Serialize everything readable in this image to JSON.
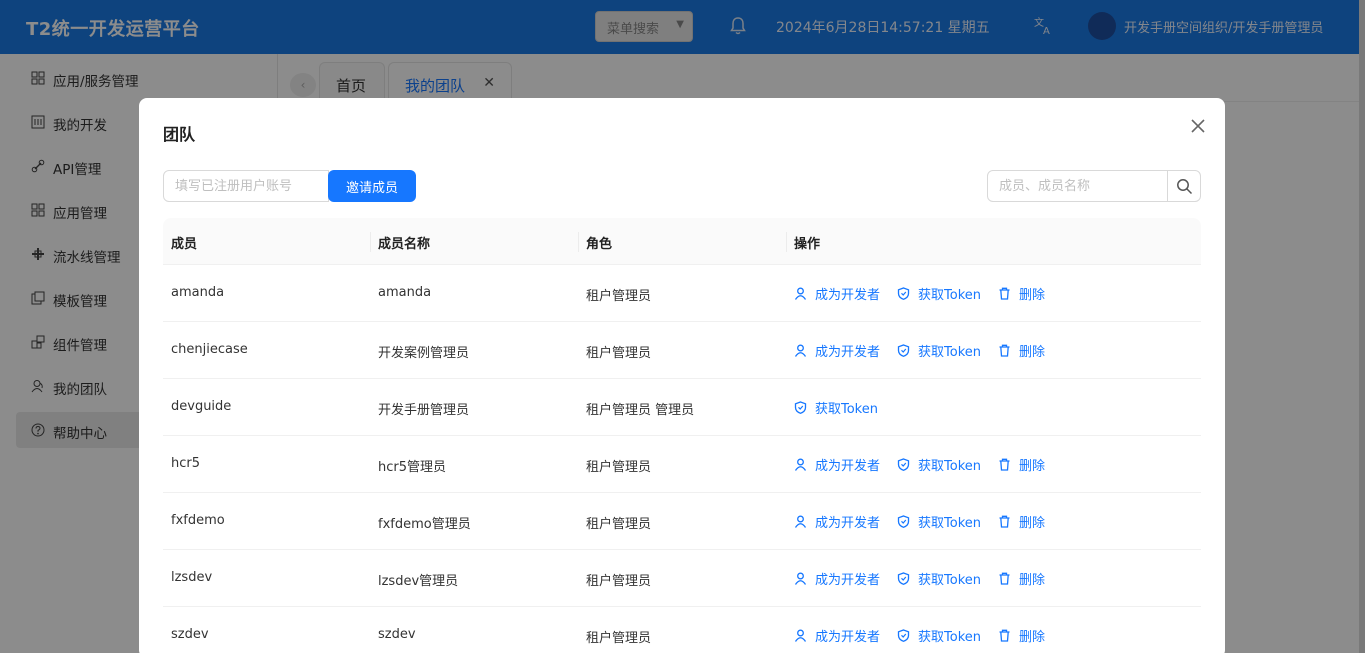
{
  "app": {
    "title": "T2统一开发运营平台",
    "menu_search_label": "菜单搜索",
    "datetime": "2024年6月28日14:57:21 星期五",
    "user_org": "开发手册空间组织/开发手册管理员"
  },
  "sidebar": {
    "items": [
      {
        "label": "应用/服务管理",
        "icon": "grid-apps-icon"
      },
      {
        "label": "我的开发",
        "icon": "code-window-icon"
      },
      {
        "label": "API管理",
        "icon": "link-icon"
      },
      {
        "label": "应用管理",
        "icon": "apps-icon"
      },
      {
        "label": "流水线管理",
        "icon": "pipeline-icon"
      },
      {
        "label": "模板管理",
        "icon": "template-icon"
      },
      {
        "label": "组件管理",
        "icon": "component-icon"
      },
      {
        "label": "我的团队",
        "icon": "team-icon"
      },
      {
        "label": "帮助中心",
        "icon": "help-icon"
      }
    ],
    "active_index": 8
  },
  "tabs": [
    {
      "label": "首页"
    },
    {
      "label": "我的团队"
    }
  ],
  "modal": {
    "title": "团队",
    "invite_placeholder": "填写已注册用户账号",
    "invite_button": "邀请成员",
    "search_placeholder": "成员、成员名称",
    "columns": [
      "成员",
      "成员名称",
      "角色",
      "操作"
    ],
    "action_labels": {
      "become_dev": "成为开发者",
      "get_token": "获取Token",
      "delete": "删除"
    },
    "rows": [
      {
        "member": "amanda",
        "name": "amanda",
        "role": "租户管理员",
        "actions": [
          "become_dev",
          "get_token",
          "delete"
        ]
      },
      {
        "member": "chenjiecase",
        "name": "开发案例管理员",
        "role": "租户管理员",
        "actions": [
          "become_dev",
          "get_token",
          "delete"
        ]
      },
      {
        "member": "devguide",
        "name": "开发手册管理员",
        "role": "租户管理员 管理员",
        "actions": [
          "get_token"
        ]
      },
      {
        "member": "hcr5",
        "name": "hcr5管理员",
        "role": "租户管理员",
        "actions": [
          "become_dev",
          "get_token",
          "delete"
        ]
      },
      {
        "member": "fxfdemo",
        "name": "fxfdemo管理员",
        "role": "租户管理员",
        "actions": [
          "become_dev",
          "get_token",
          "delete"
        ]
      },
      {
        "member": "lzsdev",
        "name": "lzsdev管理员",
        "role": "租户管理员",
        "actions": [
          "become_dev",
          "get_token",
          "delete"
        ]
      },
      {
        "member": "szdev",
        "name": "szdev",
        "role": "租户管理员",
        "actions": [
          "become_dev",
          "get_token",
          "delete"
        ]
      }
    ]
  },
  "colors": {
    "topbar": "#1a7ae6",
    "primary": "#1677ff",
    "overlay": "rgba(0,0,0,0.45)"
  }
}
